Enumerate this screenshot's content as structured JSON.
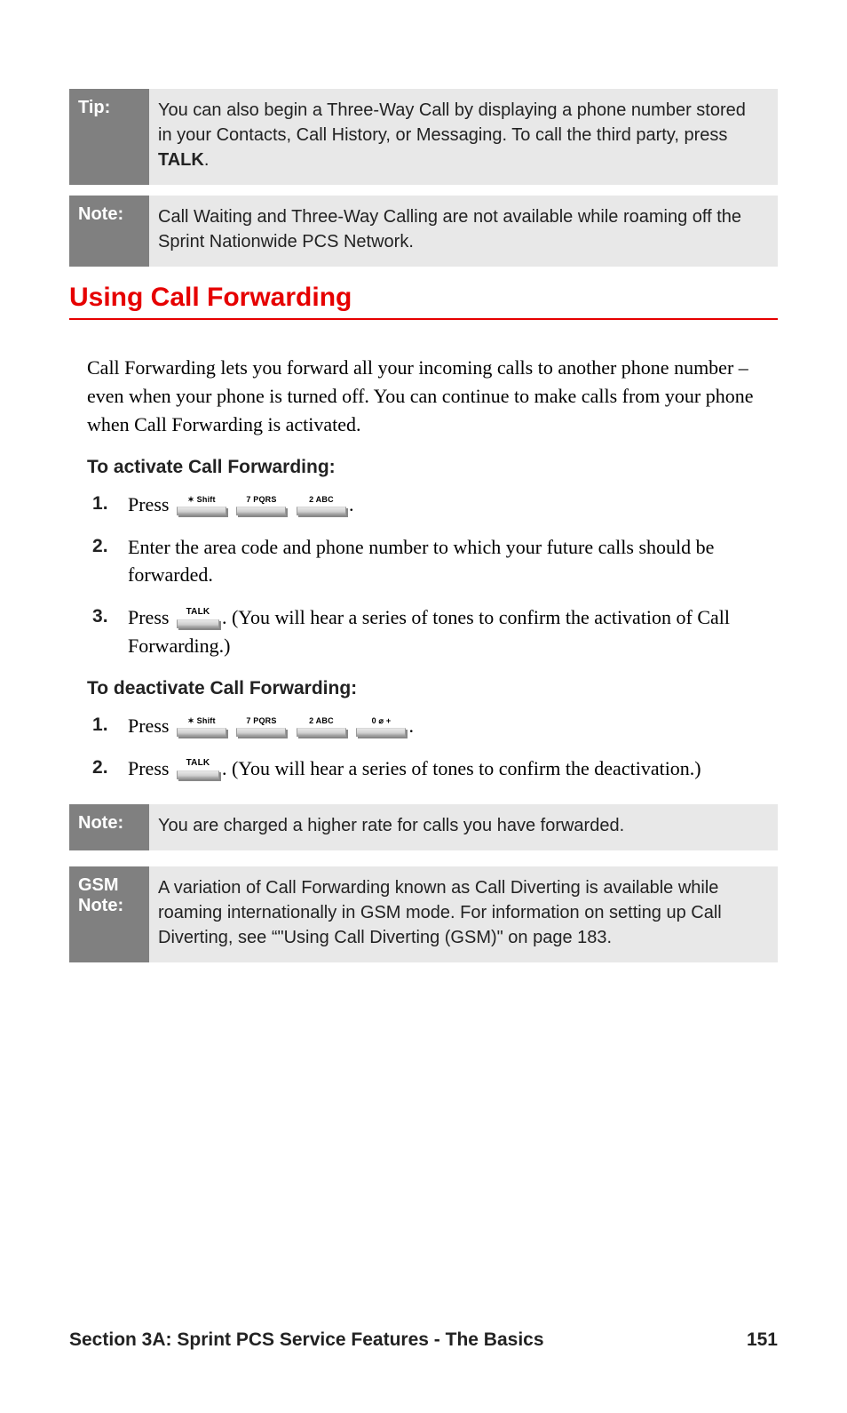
{
  "tip": {
    "label": "Tip:",
    "text_before": "You can also begin a Three-Way Call by displaying a phone number stored in your Contacts, Call History, or Messaging. To call the third party, press ",
    "bold": "TALK",
    "text_after": "."
  },
  "note1": {
    "label": "Note:",
    "text": "Call Waiting and Three-Way Calling are not available while roaming off the Sprint Nationwide PCS Network."
  },
  "heading": "Using Call Forwarding",
  "intro": "Call Forwarding lets you forward all your incoming calls to another phone number – even when your phone is turned off. You can continue to make calls from your phone when Call Forwarding is activated.",
  "activate_heading": "To activate Call Forwarding:",
  "activate_steps": {
    "s1_prefix": "Press ",
    "s1_suffix": ".",
    "s2": "Enter the area code and phone number to which your future calls should be forwarded.",
    "s3_prefix": "Press ",
    "s3_suffix": ". (You will hear a series of tones to confirm the activation of Call Forwarding.)"
  },
  "deactivate_heading": "To deactivate Call Forwarding:",
  "deactivate_steps": {
    "s1_prefix": "Press ",
    "s1_suffix": ".",
    "s2_prefix": "Press ",
    "s2_suffix": ". (You will hear a series of tones to confirm the deactivation.)"
  },
  "note2": {
    "label": "Note:",
    "text": "You are charged a higher rate for calls you have forwarded."
  },
  "gsm_note": {
    "label": "GSM Note:",
    "text": "A variation of Call Forwarding known as Call Diverting is available while roaming internationally in GSM mode. For information on setting up Call Diverting, see “\"Using Call Diverting (GSM)\" on page 183."
  },
  "keys": {
    "star": "✶ Shift",
    "seven": "7 PQRS",
    "two": "2 ABC",
    "zero": "0 ⌀ +",
    "talk": "TALK"
  },
  "footer": {
    "section": "Section 3A: Sprint PCS Service Features - The Basics",
    "page": "151"
  }
}
